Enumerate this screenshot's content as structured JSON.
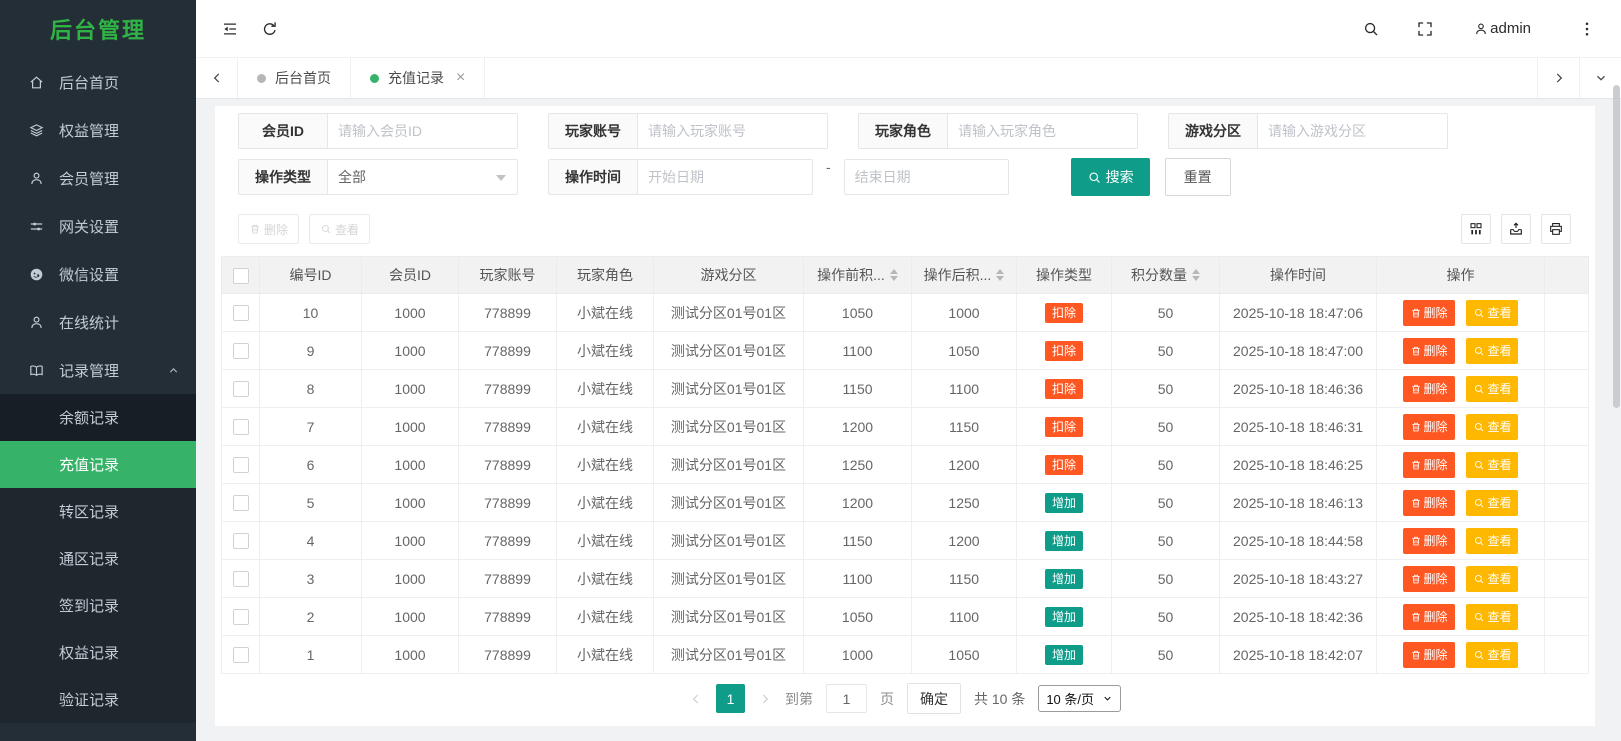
{
  "app": {
    "title": "后台管理"
  },
  "sidebar": {
    "items": [
      {
        "label": "后台首页",
        "icon": "home-icon"
      },
      {
        "label": "权益管理",
        "icon": "layers-icon"
      },
      {
        "label": "会员管理",
        "icon": "user-icon"
      },
      {
        "label": "网关设置",
        "icon": "sliders-icon"
      },
      {
        "label": "微信设置",
        "icon": "wechat-icon"
      },
      {
        "label": "在线统计",
        "icon": "user-icon"
      },
      {
        "label": "记录管理",
        "icon": "book-icon",
        "expanded": true
      }
    ],
    "submenu": [
      {
        "label": "余额记录"
      },
      {
        "label": "充值记录",
        "active": true
      },
      {
        "label": "转区记录"
      },
      {
        "label": "通区记录"
      },
      {
        "label": "签到记录"
      },
      {
        "label": "权益记录"
      },
      {
        "label": "验证记录"
      }
    ]
  },
  "header": {
    "username": "admin",
    "left_icons": [
      "collapse-icon",
      "refresh-icon"
    ],
    "right_icons": [
      "search-icon",
      "fullscreen-icon",
      "user-icon",
      "more-vert-icon"
    ]
  },
  "tabbar": {
    "tabs": [
      {
        "label": "后台首页",
        "active": false
      },
      {
        "label": "充值记录",
        "active": true,
        "closable": true
      }
    ]
  },
  "filters": {
    "member_id_label": "会员ID",
    "member_id_placeholder": "请输入会员ID",
    "player_account_label": "玩家账号",
    "player_account_placeholder": "请输入玩家账号",
    "player_role_label": "玩家角色",
    "player_role_placeholder": "请输入玩家角色",
    "game_zone_label": "游戏分区",
    "game_zone_placeholder": "请输入游戏分区",
    "op_type_label": "操作类型",
    "op_type_value": "全部",
    "op_time_label": "操作时间",
    "start_date_placeholder": "开始日期",
    "date_separator": "-",
    "end_date_placeholder": "结束日期",
    "search_label": "搜索",
    "reset_label": "重置"
  },
  "toolbar": {
    "delete_label": "删除",
    "view_label": "查看"
  },
  "table": {
    "headers": [
      "编号ID",
      "会员ID",
      "玩家账号",
      "玩家角色",
      "游戏分区",
      "操作前积...",
      "操作后积...",
      "操作类型",
      "积分数量",
      "操作时间",
      "操作"
    ],
    "delete_label": "删除",
    "view_label": "查看",
    "op_type_styles": {
      "扣除": "badge-deduct",
      "增加": "badge-add"
    },
    "rows": [
      {
        "id": "10",
        "member_id": "1000",
        "account": "778899",
        "role": "小斌在线",
        "zone": "测试分区01号01区",
        "before": "1050",
        "after": "1000",
        "op_type": "扣除",
        "amount": "50",
        "time": "2025-10-18 18:47:06"
      },
      {
        "id": "9",
        "member_id": "1000",
        "account": "778899",
        "role": "小斌在线",
        "zone": "测试分区01号01区",
        "before": "1100",
        "after": "1050",
        "op_type": "扣除",
        "amount": "50",
        "time": "2025-10-18 18:47:00"
      },
      {
        "id": "8",
        "member_id": "1000",
        "account": "778899",
        "role": "小斌在线",
        "zone": "测试分区01号01区",
        "before": "1150",
        "after": "1100",
        "op_type": "扣除",
        "amount": "50",
        "time": "2025-10-18 18:46:36"
      },
      {
        "id": "7",
        "member_id": "1000",
        "account": "778899",
        "role": "小斌在线",
        "zone": "测试分区01号01区",
        "before": "1200",
        "after": "1150",
        "op_type": "扣除",
        "amount": "50",
        "time": "2025-10-18 18:46:31"
      },
      {
        "id": "6",
        "member_id": "1000",
        "account": "778899",
        "role": "小斌在线",
        "zone": "测试分区01号01区",
        "before": "1250",
        "after": "1200",
        "op_type": "扣除",
        "amount": "50",
        "time": "2025-10-18 18:46:25"
      },
      {
        "id": "5",
        "member_id": "1000",
        "account": "778899",
        "role": "小斌在线",
        "zone": "测试分区01号01区",
        "before": "1200",
        "after": "1250",
        "op_type": "增加",
        "amount": "50",
        "time": "2025-10-18 18:46:13"
      },
      {
        "id": "4",
        "member_id": "1000",
        "account": "778899",
        "role": "小斌在线",
        "zone": "测试分区01号01区",
        "before": "1150",
        "after": "1200",
        "op_type": "增加",
        "amount": "50",
        "time": "2025-10-18 18:44:58"
      },
      {
        "id": "3",
        "member_id": "1000",
        "account": "778899",
        "role": "小斌在线",
        "zone": "测试分区01号01区",
        "before": "1100",
        "after": "1150",
        "op_type": "增加",
        "amount": "50",
        "time": "2025-10-18 18:43:27"
      },
      {
        "id": "2",
        "member_id": "1000",
        "account": "778899",
        "role": "小斌在线",
        "zone": "测试分区01号01区",
        "before": "1050",
        "after": "1100",
        "op_type": "增加",
        "amount": "50",
        "time": "2025-10-18 18:42:36"
      },
      {
        "id": "1",
        "member_id": "1000",
        "account": "778899",
        "role": "小斌在线",
        "zone": "测试分区01号01区",
        "before": "1000",
        "after": "1050",
        "op_type": "增加",
        "amount": "50",
        "time": "2025-10-18 18:42:07"
      }
    ]
  },
  "pagination": {
    "current_page": "1",
    "goto_prefix": "到第",
    "goto_value": "1",
    "goto_suffix": "页",
    "confirm_label": "确定",
    "total_text": "共 10 条",
    "page_size_text": "10 条/页"
  },
  "colors": {
    "brand_green": "#2fb344",
    "active_green": "#36b368",
    "teal": "#0f9d8a",
    "danger_orange": "#ff5722",
    "warning_yellow": "#ffb800"
  }
}
